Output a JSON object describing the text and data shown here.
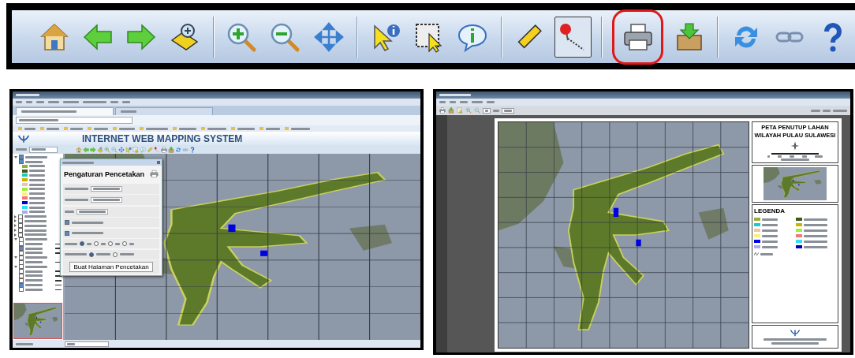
{
  "toolbar": {
    "groups": [
      [
        {
          "kind": "home",
          "pressed": false,
          "highlighted": false
        },
        {
          "kind": "back",
          "pressed": false,
          "highlighted": false
        },
        {
          "kind": "forward",
          "pressed": false,
          "highlighted": false
        },
        {
          "kind": "zoom-map",
          "pressed": false,
          "highlighted": false
        }
      ],
      [
        {
          "kind": "zoom-in",
          "pressed": false,
          "highlighted": false
        },
        {
          "kind": "zoom-out",
          "pressed": false,
          "highlighted": false
        },
        {
          "kind": "pan",
          "pressed": false,
          "highlighted": false
        }
      ],
      [
        {
          "kind": "pointer-info",
          "pressed": false,
          "highlighted": false
        },
        {
          "kind": "box-select",
          "pressed": false,
          "highlighted": false
        },
        {
          "kind": "info",
          "pressed": false,
          "highlighted": false
        }
      ],
      [
        {
          "kind": "ruler",
          "pressed": false,
          "highlighted": false
        },
        {
          "kind": "pin",
          "pressed": true,
          "highlighted": false
        }
      ],
      [
        {
          "kind": "print",
          "pressed": false,
          "highlighted": true
        },
        {
          "kind": "download",
          "pressed": false,
          "highlighted": false
        }
      ],
      [
        {
          "kind": "refresh",
          "pressed": false,
          "highlighted": false
        },
        {
          "kind": "link",
          "pressed": false,
          "highlighted": false
        },
        {
          "kind": "help",
          "pressed": false,
          "highlighted": false
        }
      ]
    ]
  },
  "browser": {
    "tabs": [
      {
        "selected": true
      },
      {
        "selected": false
      }
    ]
  },
  "app": {
    "title": "INTERNET WEB MAPPING SYSTEM",
    "tools": [
      {
        "kind": "home"
      },
      {
        "kind": "back"
      },
      {
        "kind": "forward"
      },
      {
        "kind": "zoom-map"
      },
      {
        "kind": "zoom-in"
      },
      {
        "kind": "zoom-out"
      },
      {
        "kind": "pan"
      },
      {
        "kind": "pointer-info"
      },
      {
        "kind": "box-select"
      },
      {
        "kind": "info"
      },
      {
        "kind": "ruler"
      },
      {
        "kind": "pin"
      },
      {
        "kind": "print"
      },
      {
        "kind": "download"
      },
      {
        "kind": "refresh"
      },
      {
        "kind": "link"
      },
      {
        "kind": "help"
      }
    ]
  },
  "layers": [
    {
      "checked": true,
      "expanded": true,
      "children": [
        {
          "checked": true,
          "legend": [
            {
              "color": "#8db33a"
            },
            {
              "color": "#3d5a10"
            },
            {
              "color": "#1ec8c8"
            },
            {
              "color": "#c8b400"
            },
            {
              "color": "#f5c0a8"
            },
            {
              "color": "#9cf03c"
            },
            {
              "color": "#f8f07a"
            },
            {
              "color": "#f07878"
            },
            {
              "color": "#0000e0"
            },
            {
              "color": "#30e0f0"
            },
            {
              "color": "#b0a8f0"
            }
          ]
        }
      ]
    },
    {
      "checked": false,
      "expanded": false
    },
    {
      "checked": false,
      "expanded": false
    },
    {
      "checked": false,
      "expanded": false
    },
    {
      "checked": false,
      "expanded": false
    },
    {
      "checked": false,
      "expanded": false
    },
    {
      "checked": false,
      "expanded": true,
      "children": [
        {
          "checked": false
        },
        {
          "checked": true
        },
        {
          "checked": false
        }
      ]
    },
    {
      "checked": false,
      "expanded": true,
      "children": [
        {
          "checked": false
        }
      ]
    },
    {
      "checked": false,
      "expanded": true,
      "children": [
        {
          "checked": false
        },
        {
          "checked": false
        },
        {
          "checked": false
        },
        {
          "checked": true
        },
        {
          "checked": false
        }
      ]
    }
  ],
  "print_dialog": {
    "heading": "Pengaturan Pencetakan",
    "options": [
      {
        "checked": true
      },
      {
        "checked": true
      }
    ],
    "paper_size": [
      {
        "selected": true
      },
      {
        "selected": false
      },
      {
        "selected": false
      },
      {
        "selected": false
      }
    ],
    "orientation": [
      {
        "selected": true
      },
      {
        "selected": false
      }
    ],
    "button": "Buat Halaman Pencetakan"
  },
  "reader": {
    "sheet": {
      "title": "PETA PENUTUP LAHAN",
      "subtitle": "WILAYAH PULAU SULAWESI",
      "legend_title": "LEGENDA",
      "legend": [
        {
          "color": "#8db33a"
        },
        {
          "color": "#3d5a10"
        },
        {
          "color": "#1ec8c8"
        },
        {
          "color": "#c8b400"
        },
        {
          "color": "#f5c0a8"
        },
        {
          "color": "#9cf03c"
        },
        {
          "color": "#f8f07a"
        },
        {
          "color": "#f07878"
        },
        {
          "color": "#0000e0"
        },
        {
          "color": "#30e0f0"
        },
        {
          "color": "#b0a8f0"
        },
        {
          "color": "#0000c0"
        }
      ]
    }
  }
}
